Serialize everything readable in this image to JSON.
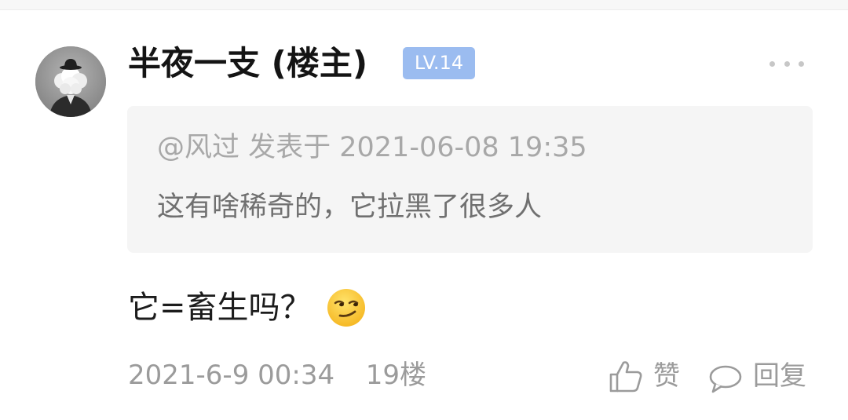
{
  "post": {
    "username": "半夜一支 (楼主)",
    "level": "LV.14",
    "quote": {
      "meta": "@风过 发表于 2021-06-08 19:35",
      "text": "这有啥稀奇的，它拉黑了很多人"
    },
    "content": "它=畜生吗？",
    "content_emoji": "smirk-emoji-icon",
    "date": "2021-6-9 00:34",
    "floor": "19楼"
  },
  "actions": {
    "like_label": "赞",
    "reply_label": "回复"
  },
  "colors": {
    "badge_bg": "#9bbcf0",
    "quote_bg": "#f5f5f5",
    "muted_text": "#9b9b9b"
  }
}
